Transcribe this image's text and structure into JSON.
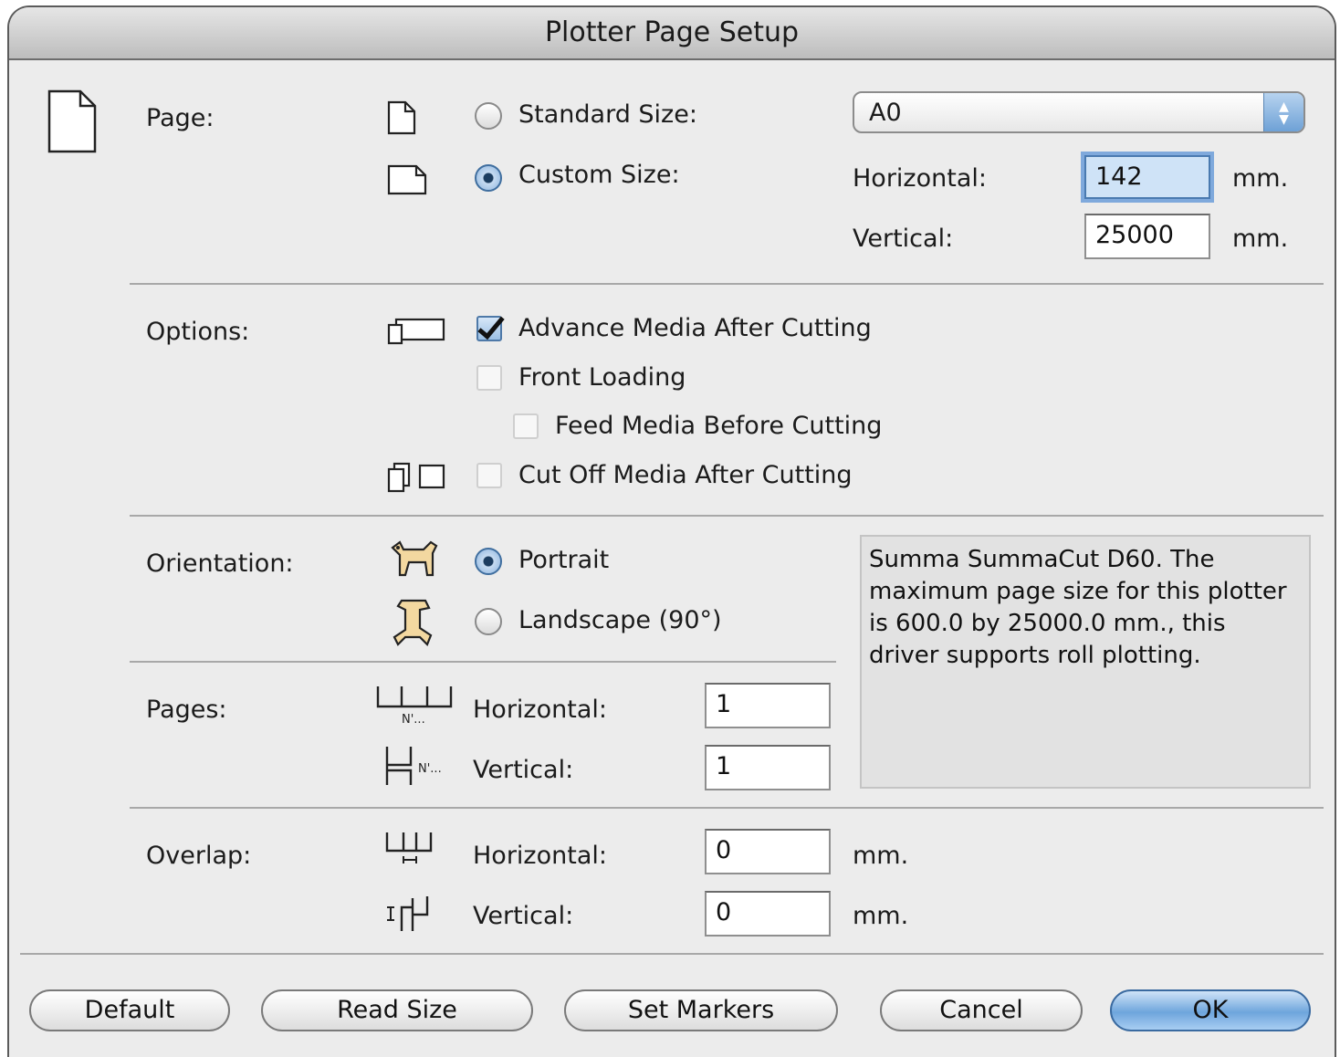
{
  "window": {
    "title": "Plotter Page Setup"
  },
  "page_section": {
    "label": "Page:",
    "standard_size_label": "Standard Size:",
    "custom_size_label": "Custom Size:",
    "standard_selected": false,
    "custom_selected": true,
    "standard_size_value": "A0",
    "horizontal_label": "Horizontal:",
    "horizontal_value": "142",
    "vertical_label": "Vertical:",
    "vertical_value": "25000",
    "unit": "mm."
  },
  "options_section": {
    "label": "Options:",
    "advance_media": {
      "label": "Advance Media After Cutting",
      "checked": true
    },
    "front_loading": {
      "label": "Front Loading",
      "checked": false
    },
    "feed_media": {
      "label": "Feed Media Before Cutting",
      "checked": false
    },
    "cut_off_media": {
      "label": "Cut Off Media After Cutting",
      "checked": false
    }
  },
  "orientation_section": {
    "label": "Orientation:",
    "portrait_label": "Portrait",
    "landscape_label": "Landscape (90°)",
    "portrait_selected": true
  },
  "info_text": "Summa SummaCut D60. The maximum page size for this plotter is 600.0 by 25000.0 mm., this driver supports roll plotting.",
  "pages_section": {
    "label": "Pages:",
    "horizontal_label": "Horizontal:",
    "horizontal_value": "1",
    "vertical_label": "Vertical:",
    "vertical_value": "1",
    "icon_text": "N'..."
  },
  "overlap_section": {
    "label": "Overlap:",
    "horizontal_label": "Horizontal:",
    "horizontal_value": "0",
    "vertical_label": "Vertical:",
    "vertical_value": "0",
    "unit": "mm."
  },
  "buttons": {
    "default": "Default",
    "read_size": "Read Size",
    "set_markers": "Set Markers",
    "cancel": "Cancel",
    "ok": "OK"
  },
  "colors": {
    "accent": "#6ea5dc",
    "window_bg": "#ececec",
    "info_bg": "#e2e2e2"
  }
}
